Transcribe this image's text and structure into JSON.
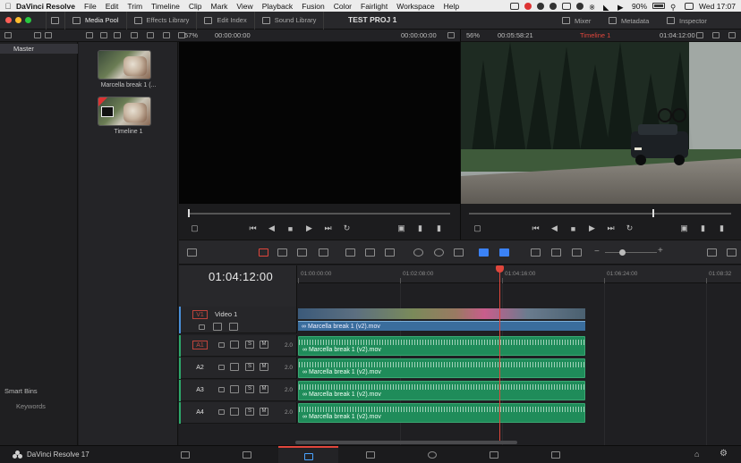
{
  "menubar": {
    "app": "DaVinci Resolve",
    "items": [
      "File",
      "Edit",
      "Trim",
      "Timeline",
      "Clip",
      "Mark",
      "View",
      "Playback",
      "Fusion",
      "Color",
      "Fairlight",
      "Workspace",
      "Help"
    ],
    "battery": "90%",
    "clock": "Wed 17:07"
  },
  "toolbar": {
    "media_pool": "Media Pool",
    "effects_library": "Effects Library",
    "edit_index": "Edit Index",
    "sound_library": "Sound Library",
    "project_title": "TEST PROJ 1",
    "mixer": "Mixer",
    "metadata": "Metadata",
    "inspector": "Inspector"
  },
  "source_viewer": {
    "zoom": "57%",
    "timecode_left": "00:00:00:00",
    "timecode_right": "00:00:00:00"
  },
  "timeline_viewer": {
    "zoom": "56%",
    "duration": "00:05:58:21",
    "timeline_name": "Timeline 1",
    "timecode": "01:04:12:00"
  },
  "bins": {
    "master": "Master",
    "smart_bins": "Smart Bins",
    "keywords": "Keywords"
  },
  "media": [
    {
      "label": "Marcella break 1 (..."
    },
    {
      "label": "Timeline 1"
    }
  ],
  "timeline": {
    "timecode": "01:04:12:00",
    "ruler": [
      "01:00:00:00",
      "01:02:08:00",
      "01:04:16:00",
      "01:06:24:00",
      "01:08:32"
    ],
    "video_track": {
      "id": "V1",
      "name": "Video 1",
      "clip": "Marcella break 1 (v2).mov"
    },
    "audio_tracks": [
      {
        "id": "A1",
        "clip": "Marcella break 1 (v2).mov",
        "channels": "2.0"
      },
      {
        "id": "A2",
        "clip": "Marcella break 1 (v2).mov",
        "channels": "2.0"
      },
      {
        "id": "A3",
        "clip": "Marcella break 1 (v2).mov",
        "channels": "2.0"
      },
      {
        "id": "A4",
        "clip": "Marcella break 1 (v2).mov",
        "channels": "2.0"
      }
    ],
    "solo_label": "S",
    "mute_label": "M"
  },
  "pagebar": {
    "brand": "DaVinci Resolve 17",
    "pages": [
      "media",
      "cut",
      "edit",
      "fusion",
      "color",
      "fairlight",
      "deliver"
    ],
    "active_page": "edit"
  },
  "colors": {
    "accent_red": "#e0463c",
    "video_clip": "#3a6d9d",
    "audio_clip": "#1f8c5a"
  }
}
